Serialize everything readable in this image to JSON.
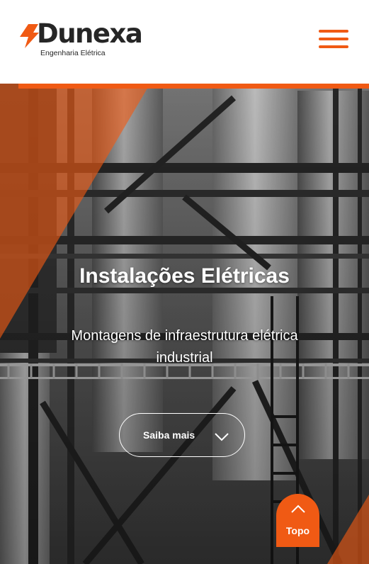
{
  "brand": {
    "name": "Dunexa",
    "tagline": "Engenharia Elétrica",
    "logo_icon": "lightning-bolt-icon",
    "accent_color": "#f05a14",
    "text_color": "#262626"
  },
  "header": {
    "menu_icon": "hamburger-menu-icon"
  },
  "hero": {
    "title": "Instalações Elétricas",
    "subtitle": "Montagens de infraestrutura elétrica industrial",
    "cta_label": "Saiba mais",
    "cta_icon": "chevron-down-icon"
  },
  "scroll_top": {
    "label": "Topo",
    "icon": "chevron-up-icon"
  }
}
